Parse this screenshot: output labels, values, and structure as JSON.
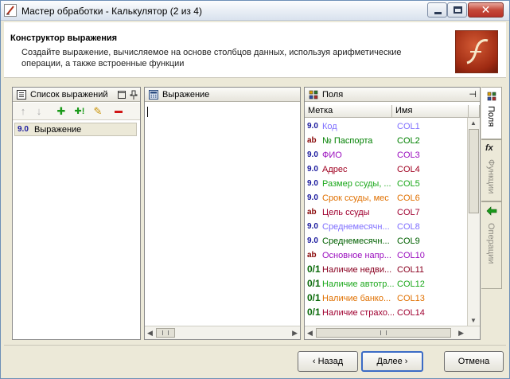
{
  "window": {
    "title": "Мастер обработки - Калькулятор (2 из 4)",
    "close_glyph": "✕"
  },
  "header": {
    "title": "Конструктор выражения",
    "description": "Создайте выражение, вычисляемое на основе столбцов данных, используя арифметические операции, а также встроенные функции"
  },
  "expressions_panel": {
    "title": "Список выражений",
    "toolbar": {
      "move_up_glyph": "↑",
      "move_down_glyph": "↓",
      "add_glyph": "✚",
      "add_special_glyph": "✚!",
      "edit_glyph": "✎",
      "delete_glyph": "▬"
    },
    "items": [
      {
        "type_badge": "9.0",
        "label": "Выражение"
      }
    ]
  },
  "expression_panel": {
    "title": "Выражение",
    "value": ""
  },
  "fields_panel": {
    "title": "Поля",
    "pin_glyph": "⊣",
    "columns": [
      "Метка",
      "Имя"
    ],
    "rows": [
      {
        "badge": "9.0",
        "label": "Код",
        "name": "COL1",
        "color": "#7f6fff"
      },
      {
        "badge": "ab",
        "label": "№ Паспорта",
        "name": "COL2",
        "color": "#008000"
      },
      {
        "badge": "9.0",
        "label": "ФИО",
        "name": "COL3",
        "color": "#9b0fbf"
      },
      {
        "badge": "9.0",
        "label": "Адрес",
        "name": "COL4",
        "color": "#a00020"
      },
      {
        "badge": "9.0",
        "label": "Размер ссуды, ...",
        "name": "COL5",
        "color": "#1ba81b"
      },
      {
        "badge": "9.0",
        "label": "Срок ссуды, мес",
        "name": "COL6",
        "color": "#e07000"
      },
      {
        "badge": "ab",
        "label": "Цель ссуды",
        "name": "COL7",
        "color": "#a00030"
      },
      {
        "badge": "9.0",
        "label": "Среднемесячн...",
        "name": "COL8",
        "color": "#7f6fff"
      },
      {
        "badge": "9.0",
        "label": "Среднемесячн...",
        "name": "COL9",
        "color": "#006000"
      },
      {
        "badge": "ab",
        "label": "Основное напр...",
        "name": "COL10",
        "color": "#9b0fbf"
      },
      {
        "badge": "0/1",
        "label": "Наличие недви...",
        "name": "COL11",
        "color": "#8a0020"
      },
      {
        "badge": "0/1",
        "label": "Наличие автотр...",
        "name": "COL12",
        "color": "#1ba81b"
      },
      {
        "badge": "0/1",
        "label": "Наличие банко...",
        "name": "COL13",
        "color": "#e07000"
      },
      {
        "badge": "0/1",
        "label": "Наличие страхо...",
        "name": "COL14",
        "color": "#a00030"
      }
    ]
  },
  "badge_colors": {
    "9.0": "#1b1b9e",
    "ab": "#8a0a0a",
    "0/1": "#0a6a0a"
  },
  "side_tabs": {
    "fields": "Поля",
    "functions": "Функции",
    "operations": "Операции",
    "fx_glyph": "fx"
  },
  "buttons": {
    "back": "‹ Назад",
    "next": "Далее ›",
    "cancel": "Отмена"
  }
}
